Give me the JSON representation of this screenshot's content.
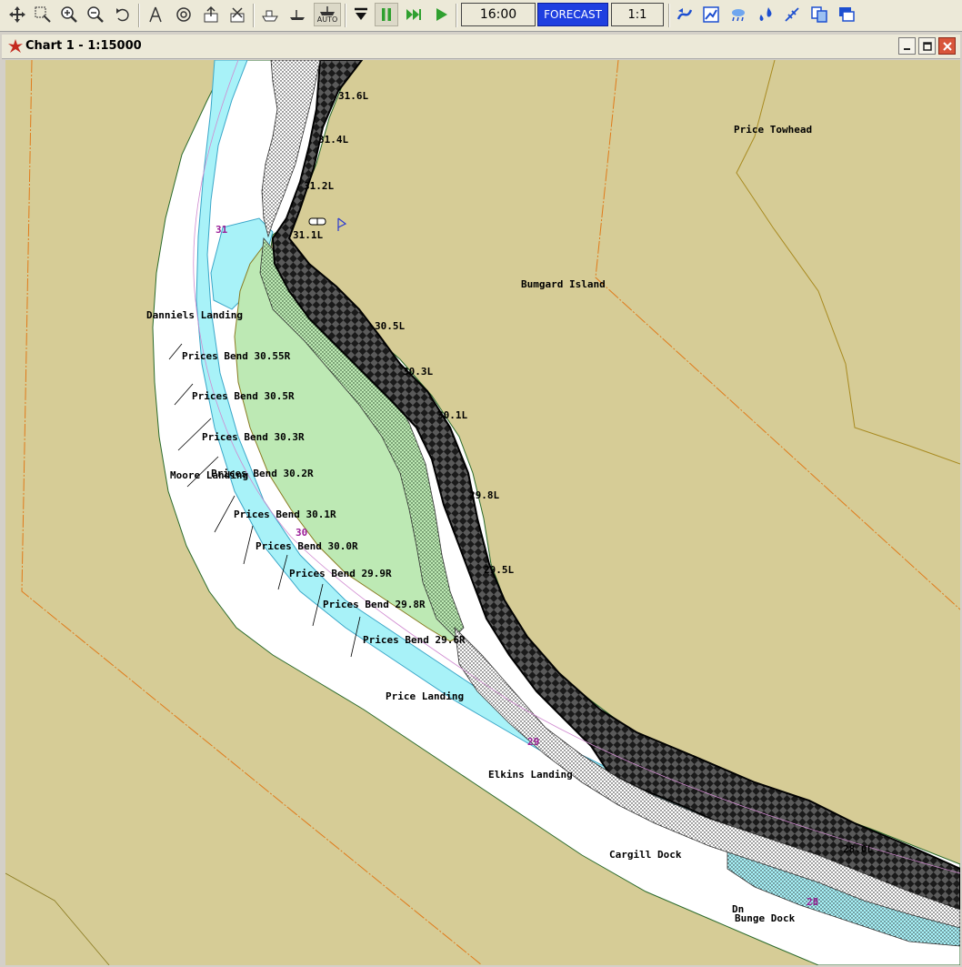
{
  "toolbar": {
    "time": "16:00",
    "forecast_label": "FORECAST",
    "scale_ratio": "1:1",
    "auto_label": "AUTO"
  },
  "window": {
    "title": "Chart 1 - 1:15000"
  },
  "colors": {
    "land": "#d6cc96",
    "water": "#ffffff",
    "shallow": "#a8f2f8",
    "island_green": "#bde9b4",
    "bank_dark": "#222222",
    "forecast_bg": "#1f3fe0",
    "mile_marker": "#9b1e98"
  },
  "chart": {
    "place_labels": {
      "price_towhead": "Price Towhead",
      "bumgard_island": "Bumgard Island",
      "danniels_landing": "Danniels Landing",
      "moore_landing": "Moore Landing",
      "price_landing": "Price Landing",
      "elkins_landing": "Elkins Landing",
      "cargill_dock": "Cargill Dock",
      "bunge_dock": "Bunge Dock",
      "dn": "Dn"
    },
    "right_bank_labels": {
      "r3055": "Prices Bend 30.55R",
      "r305": "Prices Bend 30.5R",
      "r303": "Prices Bend 30.3R",
      "r302": "Prices Bend 30.2R",
      "r301": "Prices Bend 30.1R",
      "r300": "Prices Bend 30.0R",
      "r299": "Prices Bend 29.9R",
      "r298": "Prices Bend 29.8R",
      "r296": "Prices Bend 29.6R"
    },
    "left_bank_labels": {
      "l316": "31.6L",
      "l314": "31.4L",
      "l312": "31.2L",
      "l311": "31.1L",
      "l305": "30.5L",
      "l303": "30.3L",
      "l301": "30.1L",
      "l298": "29.8L",
      "l295": "29.5L",
      "l280": "28.0L"
    },
    "mile_markers": {
      "m31": "31",
      "m30": "30",
      "m29": "29",
      "m28": "28"
    }
  }
}
